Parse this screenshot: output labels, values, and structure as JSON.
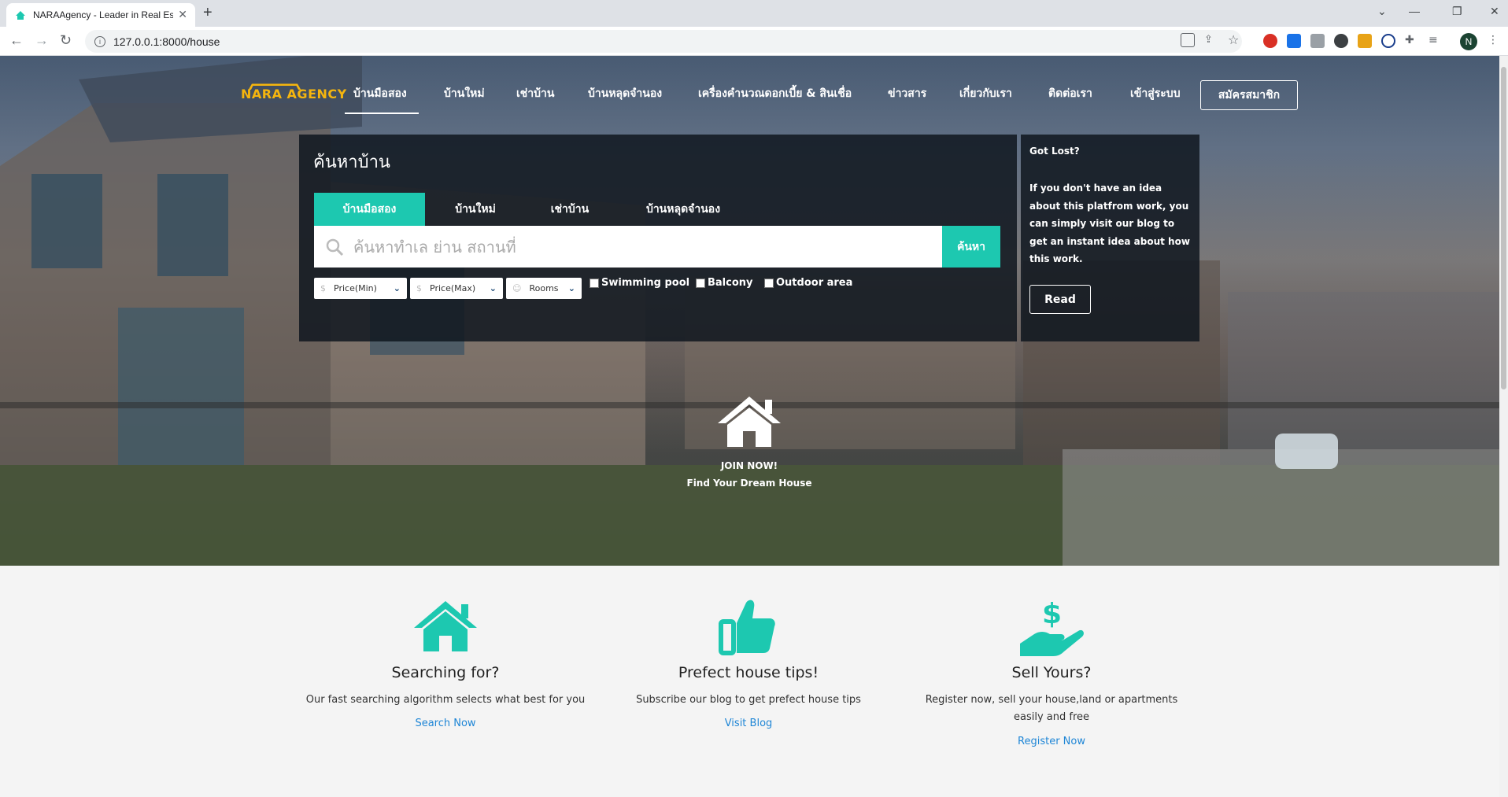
{
  "browser": {
    "tab_title": "NARAAgency - Leader in Real Est",
    "url": "127.0.0.1:8000/house",
    "profile_initial": "N"
  },
  "header": {
    "logo": "NARA AGENCY",
    "nav": [
      "บ้านมือสอง",
      "บ้านใหม่",
      "เช่าบ้าน",
      "บ้านหลุดจำนอง",
      "เครื่องคำนวณดอกเบี้ย & สินเชื่อ",
      "ข่าวสาร",
      "เกี่ยวกับเรา",
      "ติดต่อเรา",
      "เข้าสู่ระบบ"
    ],
    "signup": "สมัครสมาชิก"
  },
  "search": {
    "title": "ค้นหาบ้าน",
    "tabs": [
      "บ้านมือสอง",
      "บ้านใหม่",
      "เช่าบ้าน",
      "บ้านหลุดจำนอง"
    ],
    "placeholder": "ค้นหาทำเล ย่าน สถานที่",
    "button": "ค้นหา",
    "filters": [
      "Price(Min)",
      "Price(Max)",
      "Rooms"
    ],
    "checkboxes": [
      "Swimming pool",
      "Balcony",
      "Outdoor area"
    ]
  },
  "help": {
    "title": "Got Lost?",
    "text": "If you don't have an idea about this platfrom work, you can simply visit our blog to get an instant idea about how this work.",
    "button": "Read"
  },
  "join": {
    "line1": "JOIN NOW!",
    "line2": "Find Your Dream House"
  },
  "features": [
    {
      "title": "Searching for?",
      "desc": "Our fast searching algorithm selects what best for you",
      "link": "Search Now",
      "icon": "house-icon"
    },
    {
      "title": "Prefect house tips!",
      "desc": "Subscribe our blog to get prefect house tips",
      "link": "Visit Blog",
      "icon": "thumbs-up-icon"
    },
    {
      "title": "Sell Yours?",
      "desc": "Register now, sell your house,land or apartments easily and free",
      "link": "Register Now",
      "icon": "dollar-hand-icon"
    }
  ],
  "colors": {
    "accent": "#1dc8b0",
    "logo": "#f5b50e",
    "link": "#1f86d6"
  }
}
